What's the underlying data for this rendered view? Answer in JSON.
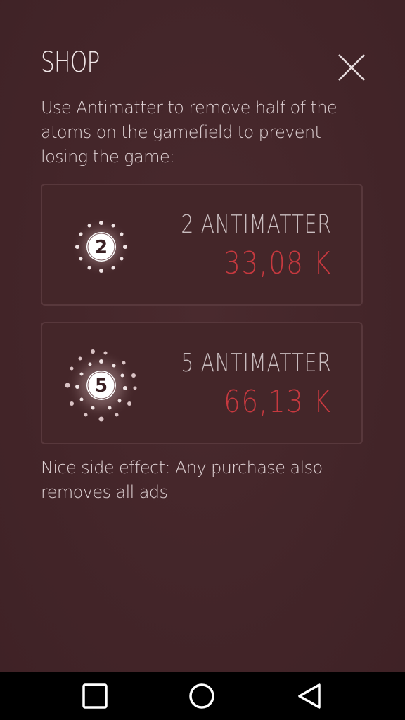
{
  "shop": {
    "title": "SHOP",
    "intro": "Use Antimatter to remove half of the atoms on the gamefield to prevent losing the game:",
    "footnote": "Nice side effect: Any purchase also removes all ads",
    "products": [
      {
        "badge": "2",
        "label": "2 ANTIMATTER",
        "price": "33,08 K",
        "icon": "atom-icon"
      },
      {
        "badge": "5",
        "label": "5 ANTIMATTER",
        "price": "66,13 K",
        "icon": "atom-icon"
      }
    ]
  },
  "navbar": {
    "recents_icon": "recents-square-icon",
    "home_icon": "home-circle-icon",
    "back_icon": "back-triangle-icon"
  },
  "colors": {
    "background": "#432529",
    "price": "#c7393f",
    "text": "#ddd0d2",
    "card_border": "#58383c"
  }
}
